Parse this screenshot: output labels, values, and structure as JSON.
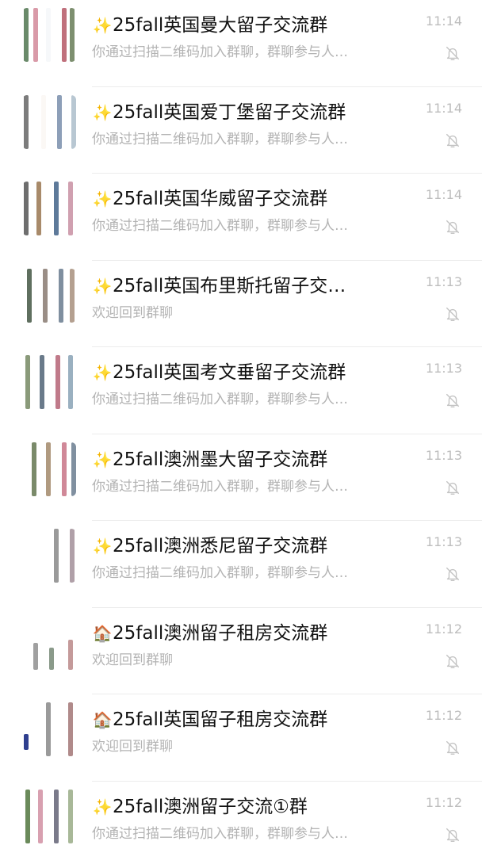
{
  "chats": [
    {
      "icon": "sparkles-icon",
      "icon_glyph": "✨",
      "title": "25fall英国曼大留子交流群",
      "preview": "你通过扫描二维码加入群聊，群聊参与人…",
      "time": "11:14",
      "muted": true
    },
    {
      "icon": "sparkles-icon",
      "icon_glyph": "✨",
      "title": "25fall英国爱丁堡留子交流群",
      "preview": "你通过扫描二维码加入群聊，群聊参与人…",
      "time": "11:14",
      "muted": true
    },
    {
      "icon": "sparkles-icon",
      "icon_glyph": "✨",
      "title": "25fall英国华威留子交流群",
      "preview": "你通过扫描二维码加入群聊，群聊参与人…",
      "time": "11:14",
      "muted": true
    },
    {
      "icon": "sparkles-icon",
      "icon_glyph": "✨",
      "title": "25fall英国布里斯托留子交…",
      "preview": "欢迎回到群聊",
      "time": "11:13",
      "muted": true
    },
    {
      "icon": "sparkles-icon",
      "icon_glyph": "✨",
      "title": "25fall英国考文垂留子交流群",
      "preview": "你通过扫描二维码加入群聊，群聊参与人…",
      "time": "11:13",
      "muted": true
    },
    {
      "icon": "sparkles-icon",
      "icon_glyph": "✨",
      "title": "25fall澳洲墨大留子交流群",
      "preview": "你通过扫描二维码加入群聊，群聊参与人…",
      "time": "11:13",
      "muted": true
    },
    {
      "icon": "sparkles-icon",
      "icon_glyph": "✨",
      "title": "25fall澳洲悉尼留子交流群",
      "preview": "你通过扫描二维码加入群聊，群聊参与人…",
      "time": "11:13",
      "muted": true
    },
    {
      "icon": "house-icon",
      "icon_glyph": "🏠",
      "title": "25fall澳洲留子租房交流群",
      "preview": "欢迎回到群聊",
      "time": "11:12",
      "muted": true
    },
    {
      "icon": "house-icon",
      "icon_glyph": "🏠",
      "title": "25fall英国留子租房交流群",
      "preview": "欢迎回到群聊",
      "time": "11:12",
      "muted": true
    },
    {
      "icon": "sparkles-icon",
      "icon_glyph": "✨",
      "title": "25fall澳洲留子交流①群",
      "preview": "你通过扫描二维码加入群聊，群聊参与人…",
      "time": "11:12",
      "muted": true
    }
  ],
  "colors": {
    "title": "#111111",
    "preview": "#b3b3b3",
    "time": "#bdbdbd",
    "divider": "#ececec",
    "mute_icon": "#c4c4c4"
  }
}
